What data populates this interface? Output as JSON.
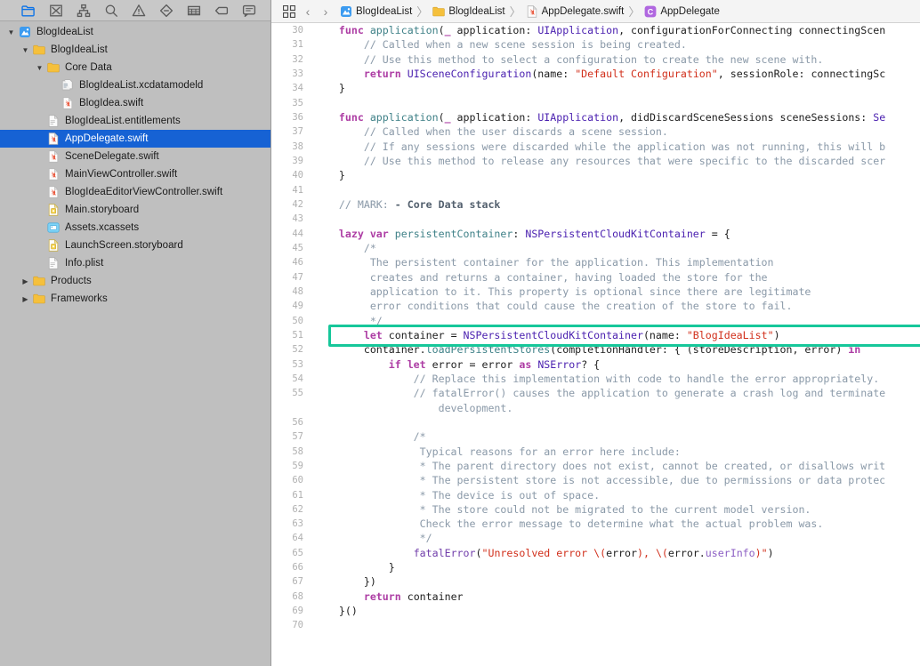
{
  "navigator": {
    "toolbar": [
      {
        "name": "project-navigator-icon",
        "glyph": "folder",
        "active": true
      },
      {
        "name": "source-control-navigator-icon",
        "glyph": "source-control",
        "active": false
      },
      {
        "name": "symbol-navigator-icon",
        "glyph": "hierarchy",
        "active": false
      },
      {
        "name": "find-navigator-icon",
        "glyph": "search",
        "active": false
      },
      {
        "name": "issue-navigator-icon",
        "glyph": "warning",
        "active": false
      },
      {
        "name": "test-navigator-icon",
        "glyph": "diamond",
        "active": false
      },
      {
        "name": "debug-navigator-icon",
        "glyph": "grid",
        "active": false
      },
      {
        "name": "breakpoint-navigator-icon",
        "glyph": "tag",
        "active": false
      },
      {
        "name": "report-navigator-icon",
        "glyph": "speech",
        "active": false
      }
    ],
    "files": [
      {
        "label": "BlogIdeaList",
        "indent": 0,
        "icon": "xcode-project",
        "twisty": "open",
        "selected": false
      },
      {
        "label": "BlogIdeaList",
        "indent": 1,
        "icon": "folder",
        "twisty": "open",
        "selected": false
      },
      {
        "label": "Core Data",
        "indent": 2,
        "icon": "folder",
        "twisty": "open",
        "selected": false
      },
      {
        "label": "BlogIdeaList.xcdatamodeld",
        "indent": 3,
        "icon": "datamodel",
        "twisty": "none",
        "selected": false
      },
      {
        "label": "BlogIdea.swift",
        "indent": 3,
        "icon": "swift",
        "twisty": "none",
        "selected": false
      },
      {
        "label": "BlogIdeaList.entitlements",
        "indent": 2,
        "icon": "plist",
        "twisty": "none",
        "selected": false
      },
      {
        "label": "AppDelegate.swift",
        "indent": 2,
        "icon": "swift",
        "twisty": "none",
        "selected": true
      },
      {
        "label": "SceneDelegate.swift",
        "indent": 2,
        "icon": "swift",
        "twisty": "none",
        "selected": false
      },
      {
        "label": "MainViewController.swift",
        "indent": 2,
        "icon": "swift",
        "twisty": "none",
        "selected": false
      },
      {
        "label": "BlogIdeaEditorViewController.swift",
        "indent": 2,
        "icon": "swift",
        "twisty": "none",
        "selected": false
      },
      {
        "label": "Main.storyboard",
        "indent": 2,
        "icon": "storyboard",
        "twisty": "none",
        "selected": false
      },
      {
        "label": "Assets.xcassets",
        "indent": 2,
        "icon": "assets",
        "twisty": "none",
        "selected": false
      },
      {
        "label": "LaunchScreen.storyboard",
        "indent": 2,
        "icon": "storyboard",
        "twisty": "none",
        "selected": false
      },
      {
        "label": "Info.plist",
        "indent": 2,
        "icon": "plist",
        "twisty": "none",
        "selected": false
      },
      {
        "label": "Products",
        "indent": 1,
        "icon": "folder",
        "twisty": "closed",
        "selected": false
      },
      {
        "label": "Frameworks",
        "indent": 1,
        "icon": "folder",
        "twisty": "closed",
        "selected": false
      }
    ]
  },
  "jump_bar": {
    "related_items_icon": "grid-icon",
    "back_arrow": "‹",
    "forward_arrow": "›",
    "separator": "〉",
    "crumbs": [
      {
        "label": "BlogIdeaList",
        "icon": "xcode-project"
      },
      {
        "label": "BlogIdeaList",
        "icon": "folder"
      },
      {
        "label": "AppDelegate.swift",
        "icon": "swift"
      },
      {
        "label": "AppDelegate",
        "icon": "class-c"
      }
    ]
  },
  "editor": {
    "highlight_color": "#16c79a",
    "highlight_line": 51,
    "first_line": 30,
    "cursor_glyph": "I",
    "lines": [
      {
        "num": "30",
        "tokens": [
          {
            "t": "    ",
            "c": "plain"
          },
          {
            "t": "func ",
            "c": "kw"
          },
          {
            "t": "application",
            "c": "fn"
          },
          {
            "t": "(",
            "c": "plain"
          },
          {
            "t": "_",
            "c": "kw"
          },
          {
            "t": " application: ",
            "c": "plain"
          },
          {
            "t": "UIApplication",
            "c": "styp"
          },
          {
            "t": ", configurationForConnecting connectingScen",
            "c": "plain"
          }
        ]
      },
      {
        "num": "31",
        "tokens": [
          {
            "t": "        // Called when a new scene session is being created.",
            "c": "com"
          }
        ]
      },
      {
        "num": "32",
        "tokens": [
          {
            "t": "        // Use this method to select a configuration to create the new scene with.",
            "c": "com"
          }
        ]
      },
      {
        "num": "33",
        "tokens": [
          {
            "t": "        ",
            "c": "plain"
          },
          {
            "t": "return ",
            "c": "kw"
          },
          {
            "t": "UISceneConfiguration",
            "c": "styp"
          },
          {
            "t": "(name: ",
            "c": "plain"
          },
          {
            "t": "\"Default Configuration\"",
            "c": "str"
          },
          {
            "t": ", sessionRole: connectingSc",
            "c": "plain"
          }
        ]
      },
      {
        "num": "34",
        "tokens": [
          {
            "t": "    }",
            "c": "plain"
          }
        ]
      },
      {
        "num": "35",
        "tokens": [
          {
            "t": "",
            "c": "plain"
          }
        ]
      },
      {
        "num": "36",
        "tokens": [
          {
            "t": "    ",
            "c": "plain"
          },
          {
            "t": "func ",
            "c": "kw"
          },
          {
            "t": "application",
            "c": "fn"
          },
          {
            "t": "(",
            "c": "plain"
          },
          {
            "t": "_",
            "c": "kw"
          },
          {
            "t": " application: ",
            "c": "plain"
          },
          {
            "t": "UIApplication",
            "c": "styp"
          },
          {
            "t": ", didDiscardSceneSessions sceneSessions: ",
            "c": "plain"
          },
          {
            "t": "Se",
            "c": "styp"
          }
        ]
      },
      {
        "num": "37",
        "tokens": [
          {
            "t": "        // Called when the user discards a scene session.",
            "c": "com"
          }
        ]
      },
      {
        "num": "38",
        "tokens": [
          {
            "t": "        // If any sessions were discarded while the application was not running, this will b",
            "c": "com"
          }
        ]
      },
      {
        "num": "39",
        "tokens": [
          {
            "t": "        // Use this method to release any resources that were specific to the discarded scer",
            "c": "com"
          }
        ]
      },
      {
        "num": "40",
        "tokens": [
          {
            "t": "    }",
            "c": "plain"
          }
        ]
      },
      {
        "num": "41",
        "tokens": [
          {
            "t": "",
            "c": "plain"
          }
        ]
      },
      {
        "num": "42",
        "tokens": [
          {
            "t": "    // MARK: ",
            "c": "com"
          },
          {
            "t": "- Core Data stack",
            "c": "comb"
          }
        ]
      },
      {
        "num": "43",
        "tokens": [
          {
            "t": "",
            "c": "plain"
          }
        ]
      },
      {
        "num": "44",
        "tokens": [
          {
            "t": "    ",
            "c": "plain"
          },
          {
            "t": "lazy var ",
            "c": "kw"
          },
          {
            "t": "persistentContainer",
            "c": "fn"
          },
          {
            "t": ": ",
            "c": "plain"
          },
          {
            "t": "NSPersistentCloudKitContainer",
            "c": "styp"
          },
          {
            "t": " = {",
            "c": "plain"
          }
        ]
      },
      {
        "num": "45",
        "tokens": [
          {
            "t": "        /*",
            "c": "com"
          }
        ]
      },
      {
        "num": "46",
        "tokens": [
          {
            "t": "         The persistent container for the application. This implementation",
            "c": "com"
          }
        ]
      },
      {
        "num": "47",
        "tokens": [
          {
            "t": "         creates and returns a container, having loaded the store for the",
            "c": "com"
          }
        ]
      },
      {
        "num": "48",
        "tokens": [
          {
            "t": "         application to it. This property is optional since there are legitimate",
            "c": "com"
          }
        ]
      },
      {
        "num": "49",
        "tokens": [
          {
            "t": "         error conditions that could cause the creation of the store to fail.",
            "c": "com"
          }
        ]
      },
      {
        "num": "50",
        "tokens": [
          {
            "t": "         */",
            "c": "com"
          }
        ]
      },
      {
        "num": "51",
        "tokens": [
          {
            "t": "        ",
            "c": "plain"
          },
          {
            "t": "let ",
            "c": "kw"
          },
          {
            "t": "container = ",
            "c": "plain"
          },
          {
            "t": "NSPersistentCloudKitContainer",
            "c": "styp"
          },
          {
            "t": "(name: ",
            "c": "plain"
          },
          {
            "t": "\"BlogIdeaList\"",
            "c": "str"
          },
          {
            "t": ")",
            "c": "plain"
          }
        ]
      },
      {
        "num": "52",
        "tokens": [
          {
            "t": "        container.",
            "c": "plain"
          },
          {
            "t": "loadPersistentStores",
            "c": "fn"
          },
          {
            "t": "(completionHandler: { (storeDescription, error) ",
            "c": "plain"
          },
          {
            "t": "in",
            "c": "kw"
          }
        ]
      },
      {
        "num": "53",
        "tokens": [
          {
            "t": "            ",
            "c": "plain"
          },
          {
            "t": "if let ",
            "c": "kw"
          },
          {
            "t": "error = error ",
            "c": "plain"
          },
          {
            "t": "as ",
            "c": "kw"
          },
          {
            "t": "NSError",
            "c": "styp"
          },
          {
            "t": "? {",
            "c": "plain"
          }
        ]
      },
      {
        "num": "54",
        "tokens": [
          {
            "t": "                // Replace this implementation with code to handle the error appropriately.",
            "c": "com"
          }
        ]
      },
      {
        "num": "55",
        "tokens": [
          {
            "t": "                // fatalError() causes the application to generate a crash log and terminate",
            "c": "com"
          }
        ]
      },
      {
        "num": "",
        "tokens": [
          {
            "t": "                    development.",
            "c": "com"
          }
        ]
      },
      {
        "num": "56",
        "tokens": [
          {
            "t": "",
            "c": "plain"
          }
        ]
      },
      {
        "num": "57",
        "tokens": [
          {
            "t": "                /*",
            "c": "com"
          }
        ]
      },
      {
        "num": "58",
        "tokens": [
          {
            "t": "                 Typical reasons for an error here include:",
            "c": "com"
          }
        ]
      },
      {
        "num": "59",
        "tokens": [
          {
            "t": "                 * The parent directory does not exist, cannot be created, or disallows writ",
            "c": "com"
          }
        ]
      },
      {
        "num": "60",
        "tokens": [
          {
            "t": "                 * The persistent store is not accessible, due to permissions or data protec",
            "c": "com"
          }
        ]
      },
      {
        "num": "61",
        "tokens": [
          {
            "t": "                 * The device is out of space.",
            "c": "com"
          }
        ]
      },
      {
        "num": "62",
        "tokens": [
          {
            "t": "                 * The store could not be migrated to the current model version.",
            "c": "com"
          }
        ]
      },
      {
        "num": "63",
        "tokens": [
          {
            "t": "                 Check the error message to determine what the actual problem was.",
            "c": "com"
          }
        ]
      },
      {
        "num": "64",
        "tokens": [
          {
            "t": "                 */",
            "c": "com"
          }
        ]
      },
      {
        "num": "65",
        "tokens": [
          {
            "t": "                ",
            "c": "plain"
          },
          {
            "t": "fatalError",
            "c": "typ"
          },
          {
            "t": "(",
            "c": "plain"
          },
          {
            "t": "\"Unresolved error \\(",
            "c": "str"
          },
          {
            "t": "error",
            "c": "plain"
          },
          {
            "t": "), \\(",
            "c": "str"
          },
          {
            "t": "error.",
            "c": "plain"
          },
          {
            "t": "userInfo",
            "c": "prop"
          },
          {
            "t": ")\"",
            "c": "str"
          },
          {
            "t": ")",
            "c": "plain"
          }
        ]
      },
      {
        "num": "66",
        "tokens": [
          {
            "t": "            }",
            "c": "plain"
          }
        ]
      },
      {
        "num": "67",
        "tokens": [
          {
            "t": "        })",
            "c": "plain"
          }
        ]
      },
      {
        "num": "68",
        "tokens": [
          {
            "t": "        ",
            "c": "plain"
          },
          {
            "t": "return ",
            "c": "kw"
          },
          {
            "t": "container",
            "c": "plain"
          }
        ]
      },
      {
        "num": "69",
        "tokens": [
          {
            "t": "    }()",
            "c": "plain"
          }
        ]
      },
      {
        "num": "70",
        "tokens": [
          {
            "t": "",
            "c": "plain"
          }
        ]
      }
    ]
  }
}
